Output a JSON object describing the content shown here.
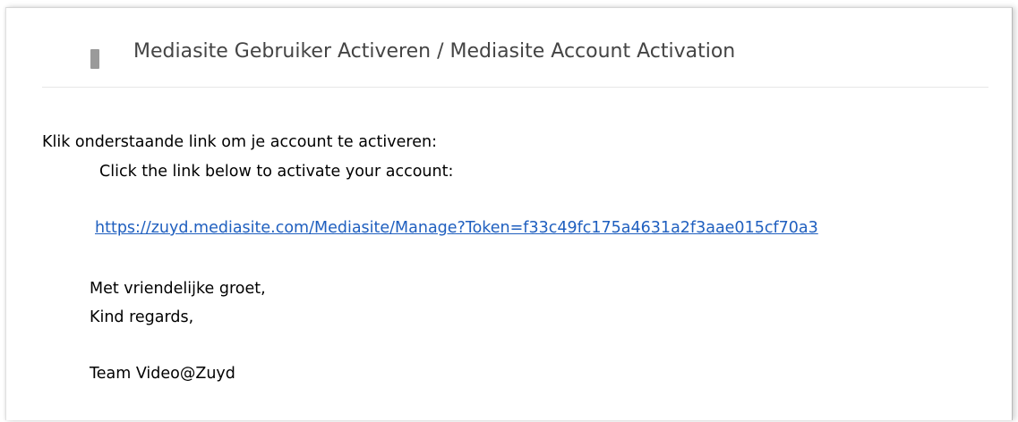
{
  "email": {
    "subject": "Mediasite Gebruiker Activeren / Mediasite Account Activation",
    "intro_nl": "Klik onderstaande link om je account te activeren:",
    "intro_en": "Click the link below to activate your account:",
    "link": "https://zuyd.mediasite.com/Mediasite/Manage?Token=f33c49fc175a4631a2f3aae015cf70a3",
    "greeting_nl": "Met vriendelijke groet,",
    "greeting_en": "Kind regards,",
    "signature": "Team Video@Zuyd"
  },
  "colors": {
    "link": "#1f5fbf",
    "subject_text": "#444444",
    "marker": "#9a9a9a"
  }
}
